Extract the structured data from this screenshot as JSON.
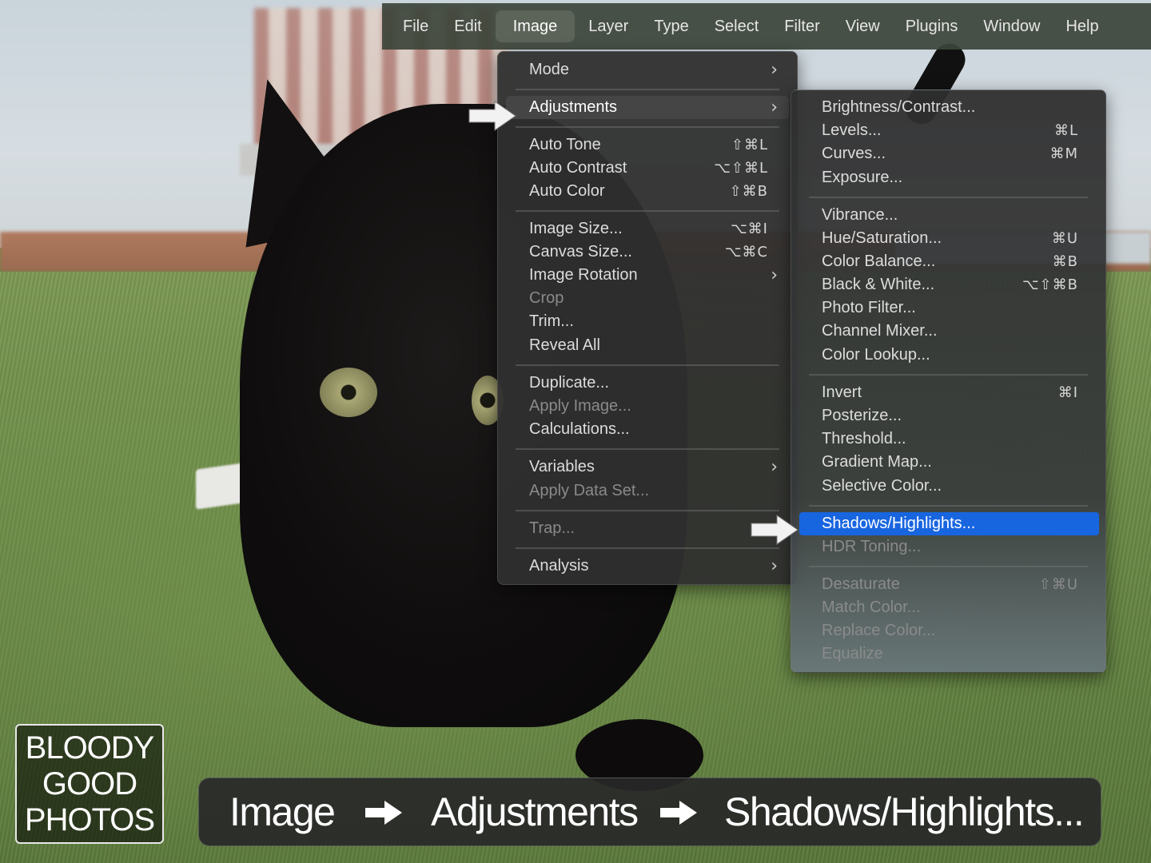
{
  "menubar": {
    "items": [
      "File",
      "Edit",
      "Image",
      "Layer",
      "Type",
      "Select",
      "Filter",
      "View",
      "Plugins",
      "Window",
      "Help"
    ],
    "active": "Image"
  },
  "image_menu": {
    "mode": {
      "label": "Mode"
    },
    "adjustments": {
      "label": "Adjustments"
    },
    "auto_tone": {
      "label": "Auto Tone",
      "shortcut": "⇧⌘L"
    },
    "auto_contrast": {
      "label": "Auto Contrast",
      "shortcut": "⌥⇧⌘L"
    },
    "auto_color": {
      "label": "Auto Color",
      "shortcut": "⇧⌘B"
    },
    "image_size": {
      "label": "Image Size...",
      "shortcut": "⌥⌘I"
    },
    "canvas_size": {
      "label": "Canvas Size...",
      "shortcut": "⌥⌘C"
    },
    "image_rotation": {
      "label": "Image Rotation"
    },
    "crop": {
      "label": "Crop"
    },
    "trim": {
      "label": "Trim..."
    },
    "reveal_all": {
      "label": "Reveal All"
    },
    "duplicate": {
      "label": "Duplicate..."
    },
    "apply_image": {
      "label": "Apply Image..."
    },
    "calculations": {
      "label": "Calculations..."
    },
    "variables": {
      "label": "Variables"
    },
    "apply_data_set": {
      "label": "Apply Data Set..."
    },
    "trap": {
      "label": "Trap..."
    },
    "analysis": {
      "label": "Analysis"
    }
  },
  "adjustments_menu": {
    "brightness_contrast": {
      "label": "Brightness/Contrast..."
    },
    "levels": {
      "label": "Levels...",
      "shortcut": "⌘L"
    },
    "curves": {
      "label": "Curves...",
      "shortcut": "⌘M"
    },
    "exposure": {
      "label": "Exposure..."
    },
    "vibrance": {
      "label": "Vibrance..."
    },
    "hue_saturation": {
      "label": "Hue/Saturation...",
      "shortcut": "⌘U"
    },
    "color_balance": {
      "label": "Color Balance...",
      "shortcut": "⌘B"
    },
    "black_white": {
      "label": "Black & White...",
      "shortcut": "⌥⇧⌘B"
    },
    "photo_filter": {
      "label": "Photo Filter..."
    },
    "channel_mixer": {
      "label": "Channel Mixer..."
    },
    "color_lookup": {
      "label": "Color Lookup..."
    },
    "invert": {
      "label": "Invert",
      "shortcut": "⌘I"
    },
    "posterize": {
      "label": "Posterize..."
    },
    "threshold": {
      "label": "Threshold..."
    },
    "gradient_map": {
      "label": "Gradient Map..."
    },
    "selective_color": {
      "label": "Selective Color..."
    },
    "shadows_highlights": {
      "label": "Shadows/Highlights..."
    },
    "hdr_toning": {
      "label": "HDR Toning..."
    },
    "desaturate": {
      "label": "Desaturate",
      "shortcut": "⇧⌘U"
    },
    "match_color": {
      "label": "Match Color..."
    },
    "replace_color": {
      "label": "Replace Color..."
    },
    "equalize": {
      "label": "Equalize"
    }
  },
  "logo": {
    "line1": "BLOODY",
    "line2": "GOOD",
    "line3": "PHOTOS"
  },
  "breadcrumb": {
    "step1": "Image",
    "step2": "Adjustments",
    "step3": "Shadows/Highlights..."
  },
  "colors": {
    "selection": "#1865e0",
    "menu_bg": "#2f2f2f",
    "menubar_bg": "#3c443a"
  },
  "icons": {
    "pointer_arrow": "arrow-icon",
    "submenu": "chevron-right-icon"
  }
}
